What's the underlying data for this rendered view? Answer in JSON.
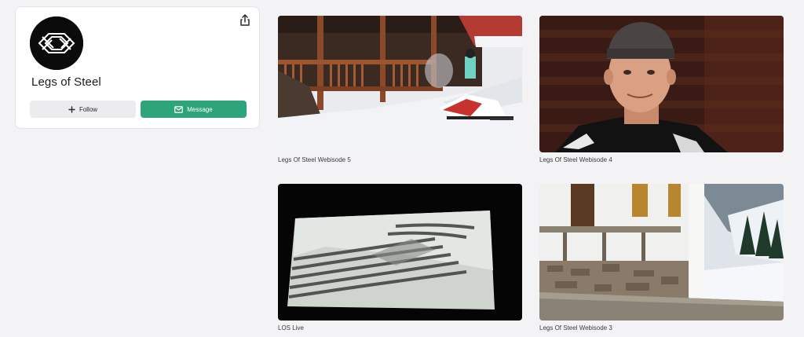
{
  "profile": {
    "name": "Legs of Steel",
    "follow_label": "Follow",
    "message_label": "Message",
    "icons": {
      "avatar": "legs-of-steel-logo",
      "share": "share-icon",
      "follow": "plus-icon",
      "message": "envelope-icon"
    }
  },
  "videos": [
    {
      "title": "Legs Of Steel Webisode 5"
    },
    {
      "title": "Legs Of Steel Webisode 4"
    },
    {
      "title": "LOS Live"
    },
    {
      "title": "Legs Of Steel Webisode 3"
    }
  ],
  "colors": {
    "background": "#f3f3f5",
    "accent": "#2ea47a",
    "follow_bg": "#ececee"
  }
}
